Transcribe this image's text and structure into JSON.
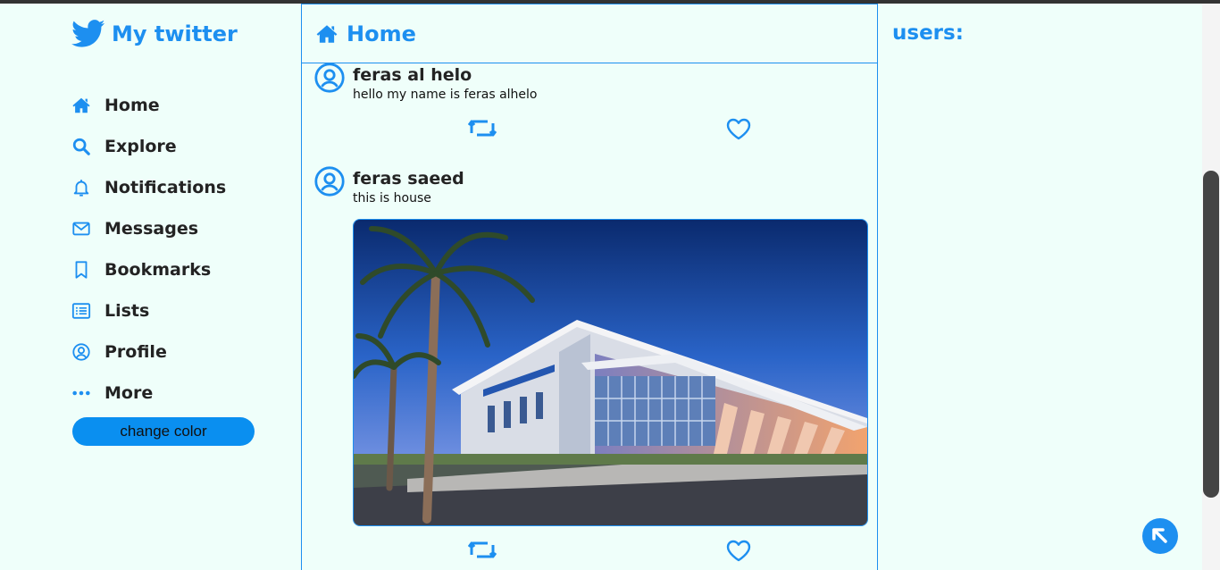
{
  "brand": {
    "title": "My twitter",
    "icon": "twitter-bird-icon"
  },
  "sidebar": {
    "items": [
      {
        "label": "Home",
        "icon": "home-icon"
      },
      {
        "label": "Explore",
        "icon": "search-icon"
      },
      {
        "label": "Notifications",
        "icon": "bell-icon"
      },
      {
        "label": "Messages",
        "icon": "envelope-icon"
      },
      {
        "label": "Bookmarks",
        "icon": "bookmark-icon"
      },
      {
        "label": "Lists",
        "icon": "list-icon"
      },
      {
        "label": "Profile",
        "icon": "user-circle-icon"
      },
      {
        "label": "More",
        "icon": "more-dots-icon"
      }
    ],
    "change_color_label": "change color"
  },
  "main": {
    "title": "Home",
    "icon": "home-icon"
  },
  "tweets": [
    {
      "name": "feras al helo",
      "text": "hello my name is feras alhelo",
      "has_image": false
    },
    {
      "name": "feras saeed",
      "text": "this is house",
      "has_image": true,
      "image": "modern-building-photo"
    }
  ],
  "right": {
    "users_title": "users:"
  },
  "colors": {
    "accent": "#1d8ff0",
    "background": "#effffa",
    "text": "#232323",
    "button": "#0a8ff0"
  }
}
